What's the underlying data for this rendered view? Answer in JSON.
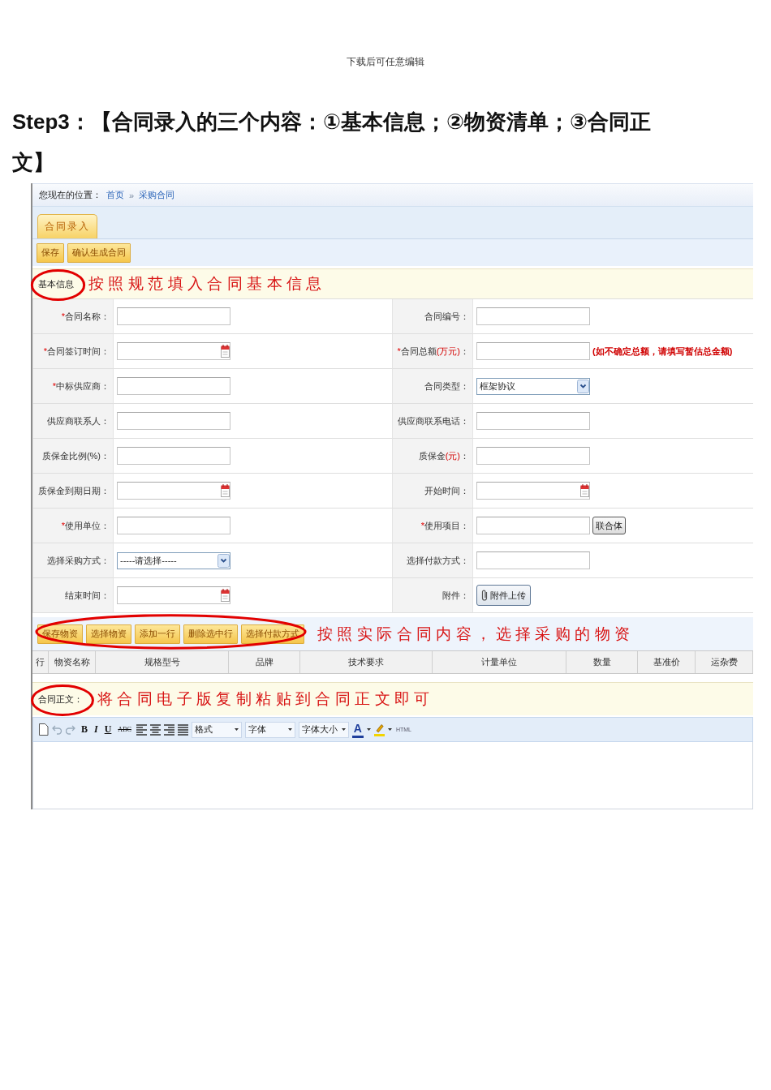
{
  "page_header": "下载后可任意编辑",
  "heading": "Step3：【合同录入的三个内容：①基本信息；②物资清单；③合同正文】",
  "app": {
    "breadcrumb": {
      "label": "您现在的位置：",
      "links": [
        "首页",
        "采购合同"
      ],
      "separator": "»"
    },
    "tabs": [
      {
        "label": "合同录入",
        "selected": true
      }
    ],
    "toolbar": [
      "保存",
      "确认生成合同"
    ],
    "basic_info": {
      "title": "基本信息",
      "circled": true,
      "annotation": "按照规范填入合同基本信息",
      "rows": [
        {
          "left": {
            "kind": "text",
            "mark": "*",
            "label": "合同名称",
            "colon": "："
          },
          "right": {
            "kind": "text",
            "label": "合同编号",
            "colon": "："
          }
        },
        {
          "left": {
            "kind": "date",
            "mark": "*",
            "label": "合同签订时间",
            "colon": "："
          },
          "right": {
            "kind": "text",
            "mark": "*",
            "label": "合同总额",
            "unit": "(万元)",
            "colon": "：",
            "note": "(如不确定总额，请填写暂估总金额)"
          }
        },
        {
          "left": {
            "kind": "text",
            "mark": "*",
            "label": "中标供应商",
            "colon": "："
          },
          "right": {
            "kind": "select",
            "label": "合同类型",
            "colon": "：",
            "value": "框架协议"
          }
        },
        {
          "left": {
            "kind": "text",
            "label": "供应商联系人",
            "colon": "："
          },
          "right": {
            "kind": "text",
            "label": "供应商联系电话",
            "colon": "："
          }
        },
        {
          "left": {
            "kind": "text",
            "label": "质保金比例(%)",
            "colon": "："
          },
          "right": {
            "kind": "text",
            "label": "质保金",
            "unit": "(元)",
            "colon": "："
          }
        },
        {
          "left": {
            "kind": "date",
            "label": "质保金到期日期",
            "colon": "："
          },
          "right": {
            "kind": "date",
            "label": "开始时间",
            "colon": "："
          }
        },
        {
          "left": {
            "kind": "text",
            "mark": "*",
            "label": "使用单位",
            "colon": "："
          },
          "right": {
            "kind": "text_button",
            "mark": "*",
            "label": "使用项目",
            "colon": "：",
            "button": "联合体"
          }
        },
        {
          "left": {
            "kind": "select",
            "label": "选择采购方式",
            "colon": "：",
            "value": "-----请选择-----"
          },
          "right": {
            "kind": "text",
            "label": "选择付款方式",
            "colon": "："
          }
        },
        {
          "left": {
            "kind": "date",
            "label": "结束时间",
            "colon": "："
          },
          "right": {
            "kind": "upload",
            "label": "附件",
            "colon": "：",
            "button": "附件上传"
          }
        }
      ]
    },
    "materials": {
      "buttons": [
        "保存物资",
        "选择物资",
        "添加一行",
        "删除选中行",
        "选择付款方式"
      ],
      "circled": true,
      "annotation": "按照实际合同内容，选择采购的物资",
      "columns": [
        "行",
        "物资名称",
        "规格型号",
        "品牌",
        "技术要求",
        "计量单位",
        "数量",
        "基准价",
        "运杂费"
      ]
    },
    "contract_text": {
      "title": "合同正文：",
      "circled": true,
      "annotation": "将合同电子版复制粘贴到合同正文即可",
      "editor": {
        "format_buttons": [
          {
            "kind": "bold",
            "label": "B"
          },
          {
            "kind": "italic",
            "label": "I"
          },
          {
            "kind": "underline",
            "label": "U"
          },
          {
            "kind": "strike",
            "label": "ABC"
          }
        ],
        "dropdowns": [
          "格式",
          "字体",
          "字体大小"
        ],
        "font_color": "A",
        "source": "HTML"
      }
    }
  }
}
